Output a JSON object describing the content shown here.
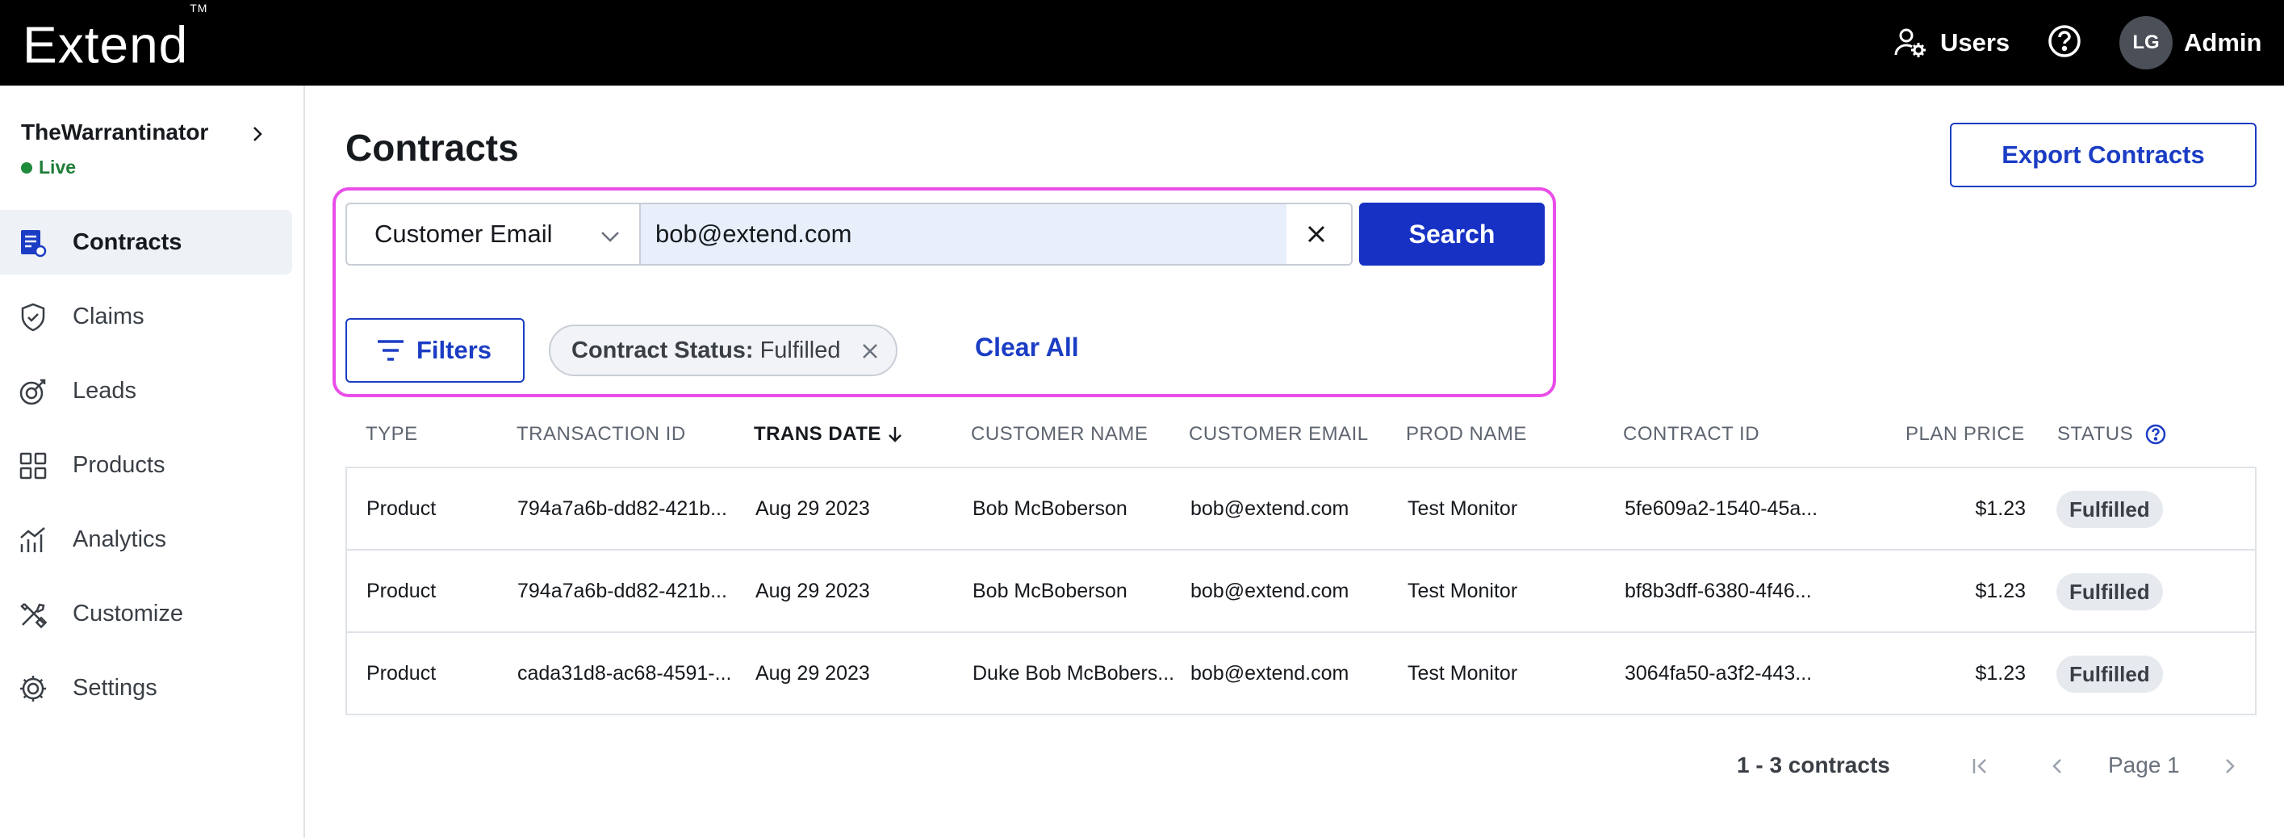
{
  "topbar": {
    "logo": "Extend",
    "logo_tm": "TM",
    "users_label": "Users",
    "avatar_initials": "LG",
    "admin_label": "Admin"
  },
  "sidebar": {
    "store_name": "TheWarrantinator",
    "store_status": "Live",
    "items": [
      {
        "label": "Contracts",
        "icon": "contracts-icon",
        "active": true
      },
      {
        "label": "Claims",
        "icon": "shield-icon"
      },
      {
        "label": "Leads",
        "icon": "leads-icon"
      },
      {
        "label": "Products",
        "icon": "grid-icon"
      },
      {
        "label": "Analytics",
        "icon": "bar-chart-icon"
      },
      {
        "label": "Customize",
        "icon": "tools-icon"
      },
      {
        "label": "Settings",
        "icon": "gear-icon"
      }
    ]
  },
  "main": {
    "title": "Contracts",
    "export_label": "Export Contracts",
    "search": {
      "field_selected": "Customer Email",
      "value": "bob@extend.com",
      "button_label": "Search"
    },
    "filters_label": "Filters",
    "chip": {
      "key": "Contract Status:",
      "value": "Fulfilled"
    },
    "clear_all_label": "Clear All"
  },
  "table": {
    "columns": [
      "TYPE",
      "TRANSACTION ID",
      "TRANS DATE",
      "CUSTOMER NAME",
      "CUSTOMER EMAIL",
      "PROD NAME",
      "CONTRACT ID",
      "PLAN PRICE",
      "STATUS"
    ],
    "rows": [
      {
        "type": "Product",
        "transaction_id": "794a7a6b-dd82-421b...",
        "trans_date": "Aug 29 2023",
        "customer_name": "Bob McBoberson",
        "customer_email": "bob@extend.com",
        "prod_name": "Test Monitor",
        "contract_id": "5fe609a2-1540-45a...",
        "plan_price": "$1.23",
        "status": "Fulfilled"
      },
      {
        "type": "Product",
        "transaction_id": "794a7a6b-dd82-421b...",
        "trans_date": "Aug 29 2023",
        "customer_name": "Bob McBoberson",
        "customer_email": "bob@extend.com",
        "prod_name": "Test Monitor",
        "contract_id": "bf8b3dff-6380-4f46...",
        "plan_price": "$1.23",
        "status": "Fulfilled"
      },
      {
        "type": "Product",
        "transaction_id": "cada31d8-ac68-4591-...",
        "trans_date": "Aug 29 2023",
        "customer_name": "Duke Bob McBobers...",
        "customer_email": "bob@extend.com",
        "prod_name": "Test Monitor",
        "contract_id": "3064fa50-a3f2-443...",
        "plan_price": "$1.23",
        "status": "Fulfilled"
      }
    ]
  },
  "pagination": {
    "count_label": "1 - 3 contracts",
    "page_label": "Page 1"
  },
  "colors": {
    "accent": "#1631c4",
    "highlight": "#e94ee9",
    "live": "#1e8a3c"
  }
}
